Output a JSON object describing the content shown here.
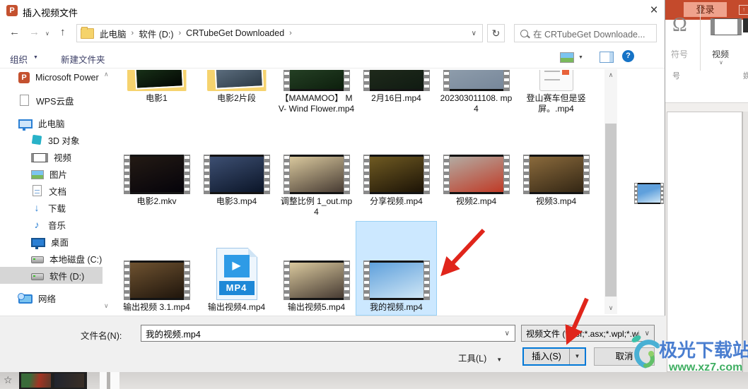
{
  "window": {
    "title": "插入视频文件",
    "close_glyph": "×"
  },
  "nav": {
    "back_glyph": "←",
    "forward_glyph": "→",
    "history_caret": "∨",
    "up_glyph": "↑",
    "breadcrumb": [
      "此电脑",
      "软件 (D:)",
      "CRTubeGet Downloaded"
    ],
    "crumb_separator": "›",
    "address_caret": "∨",
    "refresh_glyph": "↻",
    "search_placeholder": "在 CRTubeGet Downloade..."
  },
  "toolbar": {
    "organize": "组织",
    "organize_caret": "▼",
    "new_folder": "新建文件夹",
    "view_caret": "▼",
    "help_glyph": "?"
  },
  "sidebar": {
    "scroll_up": "∧",
    "scroll_down": "∨",
    "items": [
      {
        "id": "microsoft-powerpoint",
        "label": "Microsoft Power",
        "icon": "powerpoint",
        "glyph": "P"
      },
      {
        "id": "wps-cloud",
        "label": "WPS云盘",
        "icon": "page",
        "gap": true
      },
      {
        "id": "this-pc",
        "label": "此电脑",
        "icon": "monitor",
        "gap": true
      },
      {
        "id": "3d-objects",
        "label": "3D 对象",
        "icon": "cube",
        "indent": true
      },
      {
        "id": "videos",
        "label": "视频",
        "icon": "filmsm",
        "indent": true
      },
      {
        "id": "pictures",
        "label": "图片",
        "icon": "picture",
        "indent": true
      },
      {
        "id": "documents",
        "label": "文档",
        "icon": "docfile",
        "indent": true
      },
      {
        "id": "downloads",
        "label": "下载",
        "icon": "download",
        "glyph": "↓",
        "indent": true
      },
      {
        "id": "music",
        "label": "音乐",
        "icon": "music",
        "glyph": "♪",
        "indent": true
      },
      {
        "id": "desktop",
        "label": "桌面",
        "icon": "desktop",
        "indent": true
      },
      {
        "id": "local-disk-c",
        "label": "本地磁盘 (C:)",
        "icon": "disk",
        "indent": true
      },
      {
        "id": "disk-d",
        "label": "软件 (D:)",
        "icon": "disk",
        "indent": true,
        "selected": true
      },
      {
        "id": "network",
        "label": "网络",
        "icon": "network",
        "gap": true
      }
    ]
  },
  "files": {
    "mp4_badge": "MP4",
    "play_glyph": "▶",
    "scroll_up": "∧",
    "scroll_down": "∨",
    "rows": [
      [
        {
          "label": "电影1",
          "kind": "folder",
          "g1": "#1c3a1c",
          "g2": "#030603"
        },
        {
          "label": "电影2片段",
          "kind": "folder",
          "g1": "#66788a",
          "g2": "#2c3a46"
        },
        {
          "label": "【MAMAMOO】 MV- Wind Flower.mp4",
          "kind": "film-cut",
          "g1": "#2e4d2e",
          "g2": "#0d1f0d"
        },
        {
          "label": "2月16日.mp4",
          "kind": "film-cut",
          "g1": "#25301f",
          "g2": "#101b12"
        },
        {
          "label": "202303011108. mp4",
          "kind": "film-cut",
          "g1": "#97a5b2",
          "g2": "#77879a"
        },
        {
          "label": "登山赛车但是竖屏。.mp4",
          "kind": "card"
        }
      ],
      [
        {
          "label": "电影2.mkv",
          "kind": "film",
          "g1": "#231a14",
          "g2": "#05030a"
        },
        {
          "label": "电影3.mp4",
          "kind": "film",
          "g1": "#3d4f72",
          "g2": "#0b1528"
        },
        {
          "label": "调整比例 1_out.mp4",
          "kind": "film",
          "g1": "#d9c89d",
          "g2": "#473b33"
        },
        {
          "label": "分享视频.mp4",
          "kind": "film",
          "g1": "#6f5a22",
          "g2": "#1c1306"
        },
        {
          "label": "视频2.mp4",
          "kind": "film",
          "g1": "#b3aba2",
          "g2": "#c03a26"
        },
        {
          "label": "视频3.mp4",
          "kind": "film",
          "g1": "#8a6a3c",
          "g2": "#332614"
        }
      ],
      [
        {
          "label": "输出视频 3.1.mp4",
          "kind": "film",
          "g1": "#6e5230",
          "g2": "#1f150c"
        },
        {
          "label": "输出视频4.mp4",
          "kind": "mp4"
        },
        {
          "label": "输出视频5.mp4",
          "kind": "film",
          "g1": "#d9c89d",
          "g2": "#473b33"
        },
        {
          "label": "我的视频.mp4",
          "kind": "film",
          "g1": "#5fa0dc",
          "g2": "#cfe6f5",
          "selected": true
        }
      ]
    ]
  },
  "footer": {
    "filename_label": "文件名(N):",
    "filename_value": "我的视频.mp4",
    "filename_caret": "∨",
    "filetype_value": "视频文件 (*.asf;*.asx;*.wpl;*.wi",
    "filetype_caret": "∨",
    "tools_label": "工具(L)",
    "tools_caret": "▼",
    "insert_label": "插入(S)",
    "insert_caret": "▼",
    "cancel_label": "取消"
  },
  "ribbon": {
    "login": "登录",
    "symbol_glyph": "Ω",
    "symbol_label": "符号",
    "video_label": "视频",
    "video_caret": "∨",
    "group_symbol": "号",
    "group_media": "媒"
  },
  "watermark": {
    "site": "极光下载站",
    "url": "www.xz7.com"
  },
  "background": {
    "star_glyph": "☆"
  },
  "colors": {
    "selection": "#cce8ff",
    "arrow": "#e0251b",
    "titlebar_red": "#c44a2c",
    "insert_border": "#0078d7",
    "watermark_blue": "#4a7ed0",
    "watermark_green": "#3fae62"
  }
}
